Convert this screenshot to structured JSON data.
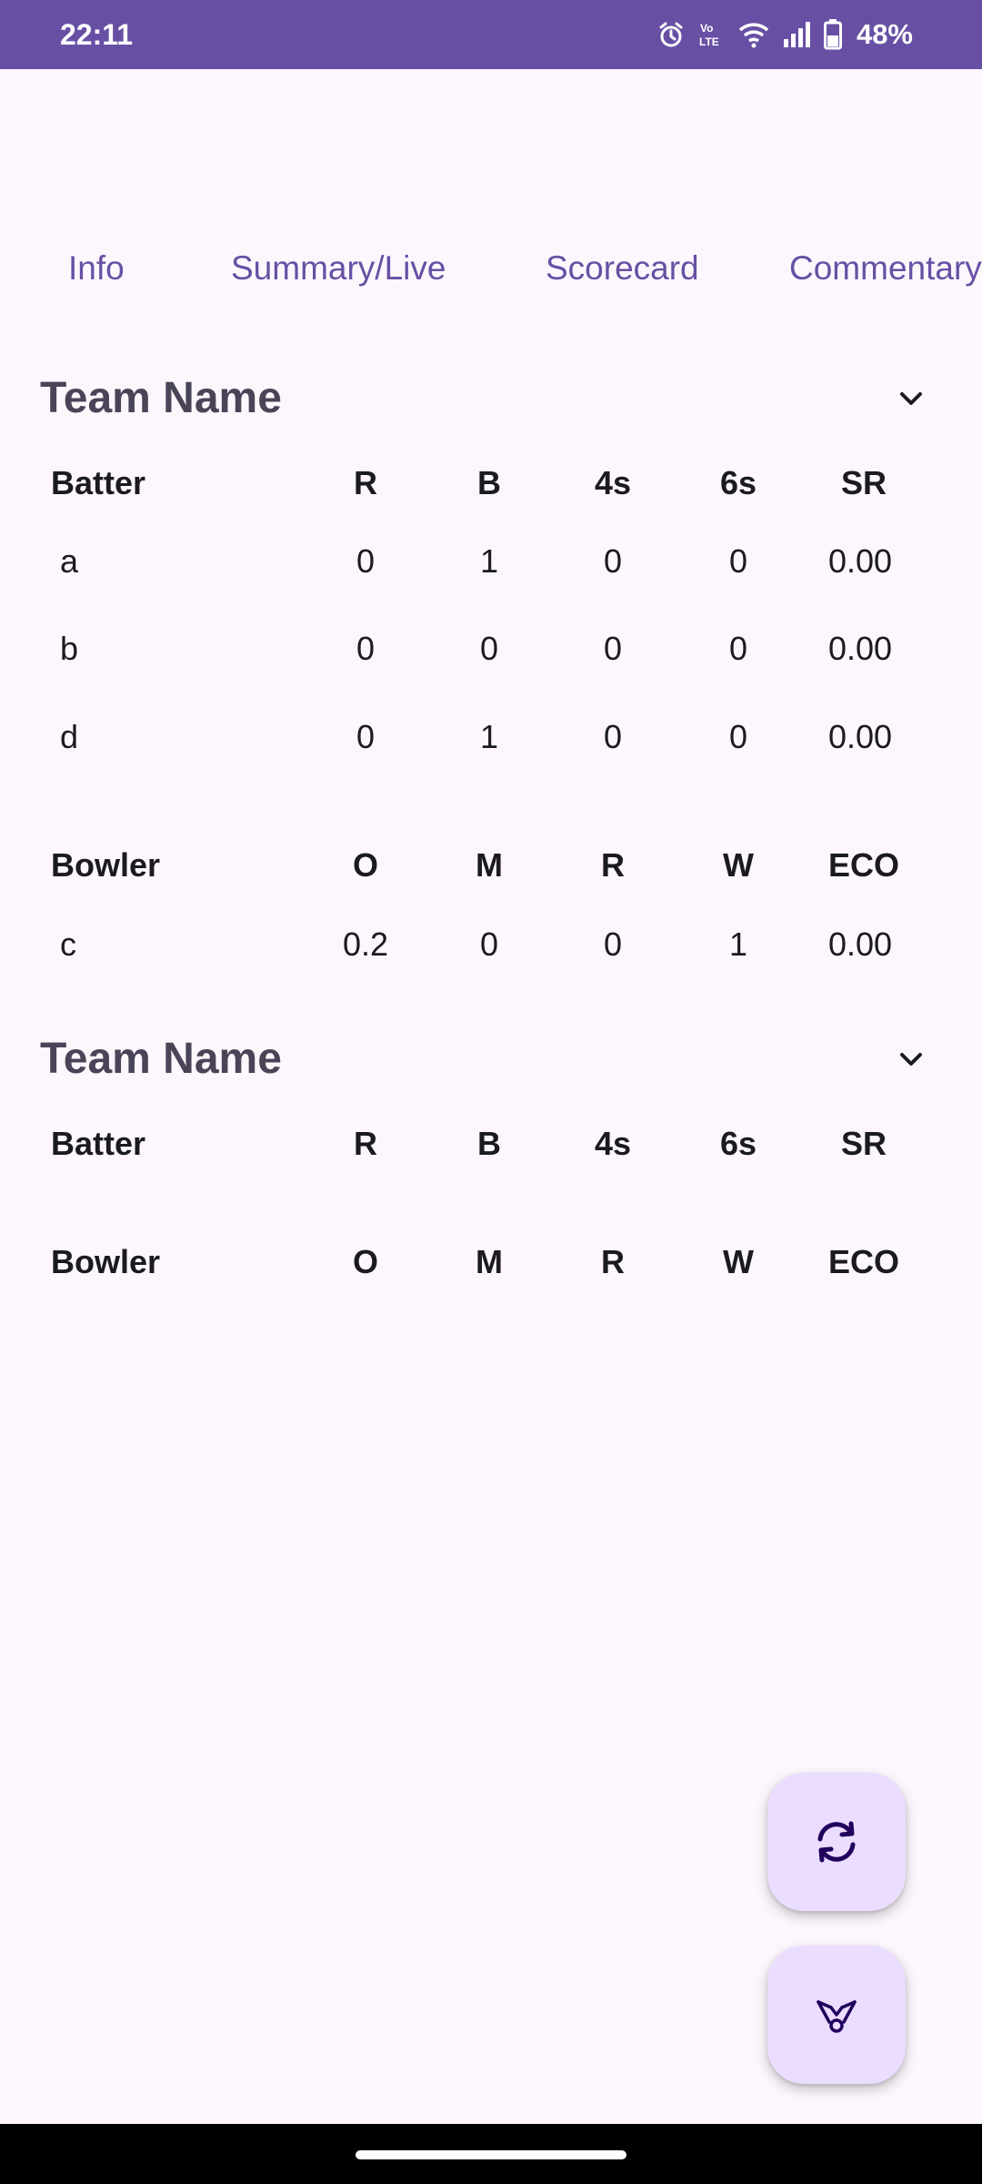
{
  "status_bar": {
    "time": "22:11",
    "battery_text": "48%",
    "icons": [
      "alarm-icon",
      "volte-icon",
      "wifi-icon",
      "signal-icon",
      "battery-icon"
    ],
    "background": "#6750a4"
  },
  "tabs": [
    {
      "label": "Info"
    },
    {
      "label": "Summary/Live"
    },
    {
      "label": "Scorecard"
    },
    {
      "label": "Commentary"
    }
  ],
  "teams": [
    {
      "name": "Team Name",
      "batting_headers": [
        "Batter",
        "R",
        "B",
        "4s",
        "6s",
        "SR"
      ],
      "batters": [
        [
          "a",
          "0",
          "1",
          "0",
          "0",
          "0.00"
        ],
        [
          "b",
          "0",
          "0",
          "0",
          "0",
          "0.00"
        ],
        [
          "d",
          "0",
          "1",
          "0",
          "0",
          "0.00"
        ]
      ],
      "bowling_headers": [
        "Bowler",
        "O",
        "M",
        "R",
        "W",
        "ECO"
      ],
      "bowlers": [
        [
          "c",
          "0.2",
          "0",
          "0",
          "1",
          "0.00"
        ]
      ]
    },
    {
      "name": "Team Name",
      "batting_headers": [
        "Batter",
        "R",
        "B",
        "4s",
        "6s",
        "SR"
      ],
      "batters": [],
      "bowling_headers": [
        "Bowler",
        "O",
        "M",
        "R",
        "W",
        "ECO"
      ],
      "bowlers": []
    }
  ],
  "fabs": [
    {
      "icon": "refresh-icon"
    },
    {
      "icon": "cricket-stumps-icon"
    }
  ],
  "colors": {
    "accent": "#6750a4",
    "background": "#fdf7fd",
    "fab": "#eaddff",
    "team_name": "#4a4458"
  }
}
